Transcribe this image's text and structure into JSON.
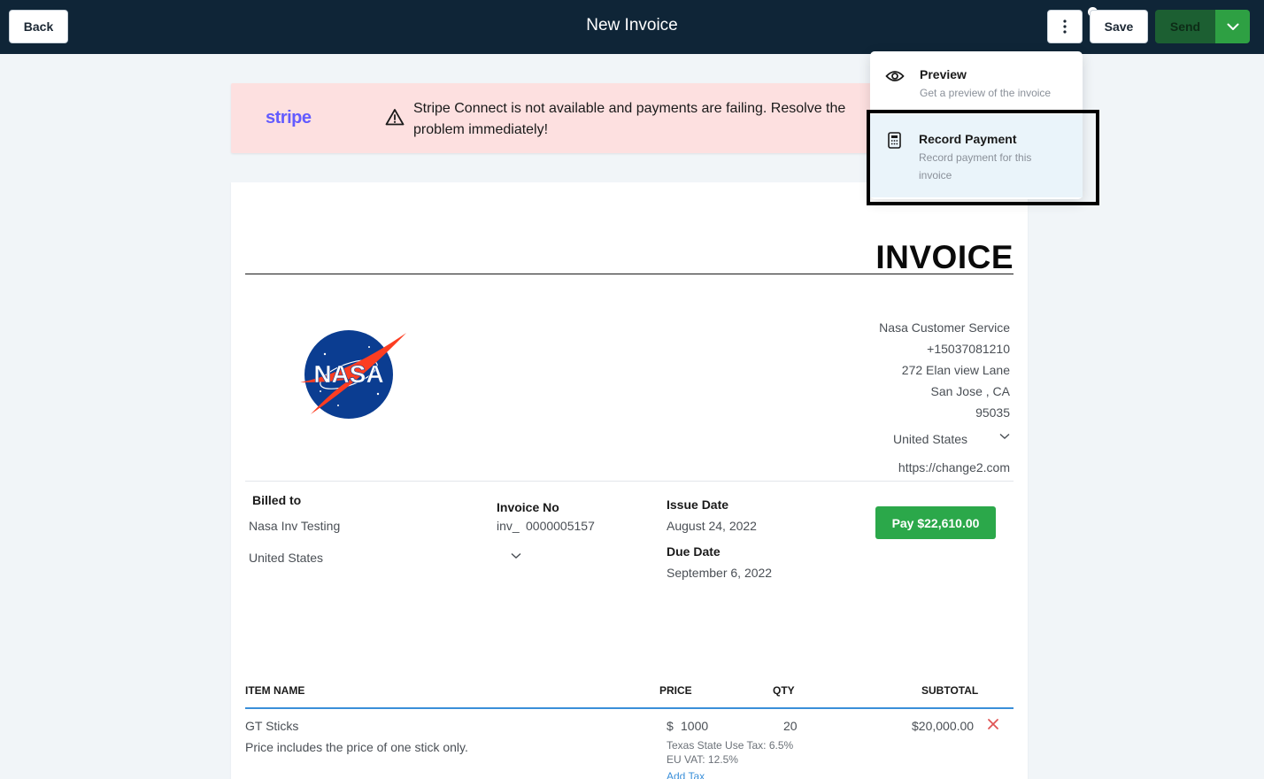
{
  "header": {
    "back_label": "Back",
    "title": "New Invoice",
    "save_label": "Save",
    "send_label": "Send"
  },
  "alert": {
    "brand": "stripe",
    "message": "Stripe Connect is not available and payments are failing. Resolve the problem immediately!"
  },
  "menu": {
    "items": [
      {
        "label": "Preview",
        "description": "Get a preview of the invoice",
        "icon": "eye-icon"
      },
      {
        "label": "Record Payment",
        "description": "Record payment for this invoice",
        "icon": "calculator-icon"
      }
    ]
  },
  "invoice": {
    "heading": "INVOICE",
    "logo_text": "NASA",
    "company": {
      "name": "Nasa Customer Service",
      "phone": "+15037081210",
      "street": "272 Elan view Lane",
      "city_state": "San Jose ,  CA",
      "zip": "95035",
      "country": "United States",
      "website": "https://change2.com"
    },
    "billed_to": {
      "label": "Billed to",
      "name": "Nasa Inv Testing",
      "country": "United States"
    },
    "invoice_no": {
      "label": "Invoice No",
      "prefix": "inv_",
      "number": "0000005157"
    },
    "issue_date": {
      "label": "Issue Date",
      "value": "August 24, 2022"
    },
    "due_date": {
      "label": "Due Date",
      "value": "September 6, 2022"
    },
    "pay_button": "Pay $22,610.00",
    "table": {
      "headers": {
        "item": "ITEM NAME",
        "price": "PRICE",
        "qty": "QTY",
        "subtotal": "SUBTOTAL"
      },
      "rows": [
        {
          "name": "GT Sticks",
          "description": "Price includes the price of one stick only.",
          "currency": "$",
          "price": "1000",
          "qty": "20",
          "subtotal": "$20,000.00",
          "taxes": [
            "Texas State Use Tax: 6.5%",
            "EU VAT: 12.5%"
          ],
          "add_tax": "Add Tax"
        }
      ]
    }
  },
  "colors": {
    "topbar": "#0f2537",
    "send": "#1c5f32",
    "pay": "#2ba84a",
    "alert_bg": "#fde0e0",
    "stripe": "#635bff",
    "accent": "#3a8fd9"
  }
}
